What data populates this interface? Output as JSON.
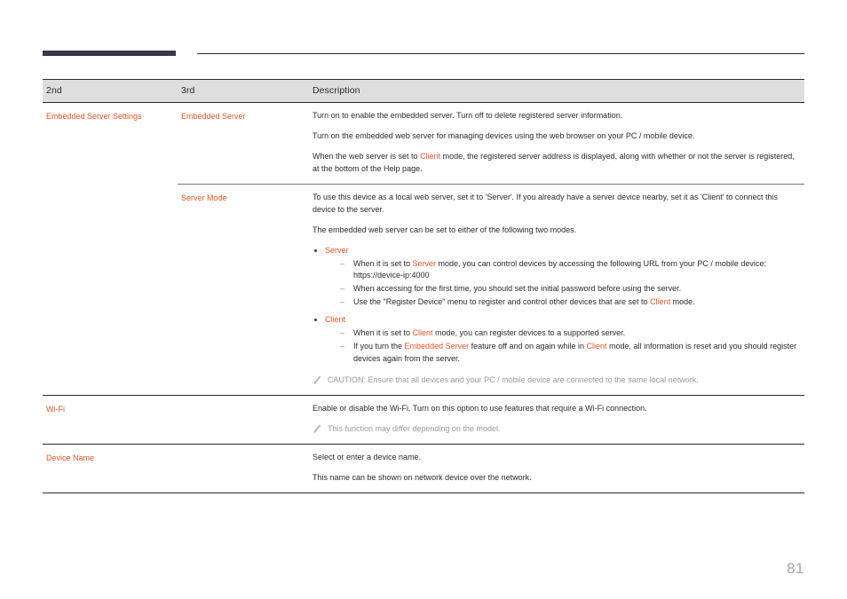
{
  "page": {
    "number": "81",
    "accent_color": "#e3552a",
    "header_bar_color": "#3b3746",
    "note_color": "#9a9a9a",
    "header_row_bg": "#dedede"
  },
  "table": {
    "headers": {
      "col1": "2nd",
      "col2": "3rd",
      "col3": "Description"
    },
    "rows": {
      "embedded_server_settings": {
        "col1": "Embedded Server Settings",
        "embedded_server": {
          "col2": "Embedded Server",
          "p1": "Turn on to enable the embedded server. Turn off to delete registered server information.",
          "p2": "Turn on the embedded web server for managing devices using the web browser on your PC / mobile device.",
          "p3_a": "When the web server is set to ",
          "p3_hl": "Client",
          "p3_b": " mode, the registered server address is displayed, along with whether or not the server is registered, at the bottom of the Help page."
        },
        "server_mode": {
          "col2": "Server Mode",
          "p1": "To use this device as a local web server, set it to 'Server'. If you already have a server device nearby, set it as 'Client' to connect this device to the server.",
          "p2": "The embedded web server can be set to either of the following two modes.",
          "bullet_server": {
            "label": "Server",
            "sub": [
              {
                "a": "When it is set to ",
                "hl": "Server",
                "b": " mode, you can control devices by accessing the following URL from your PC / mobile device: https://device-ip:4000"
              },
              {
                "a": "When accessing for the first time, you should set the initial password before using the server.",
                "hl": "",
                "b": ""
              },
              {
                "a": "Use the \"Register Device\" menu to register and control other devices that are set to ",
                "hl": "Client",
                "b": " mode."
              }
            ]
          },
          "bullet_client": {
            "label": "Client",
            "sub": [
              {
                "a": "When it is set to ",
                "hl": "Client",
                "b": " mode, you can register devices to a supported server."
              },
              {
                "a": "If you turn the ",
                "hl": "Embedded Server",
                "b": " feature off and on again while in ",
                "hl2": "Client",
                "c": " mode, all information is reset and you should register devices again from the server."
              }
            ]
          },
          "note": "CAUTION: Ensure that all devices and your PC / mobile device are connected to the same local network."
        }
      },
      "wifi": {
        "col1": "Wi-Fi",
        "p1": "Enable or disable the Wi-Fi. Turn on this option to use features that require a Wi-Fi connection.",
        "note": "This function may differ depending on the model."
      },
      "device_name": {
        "col1": "Device Name",
        "p1": "Select or enter a device name.",
        "p2": "This name can be shown on network device over the network."
      }
    }
  }
}
